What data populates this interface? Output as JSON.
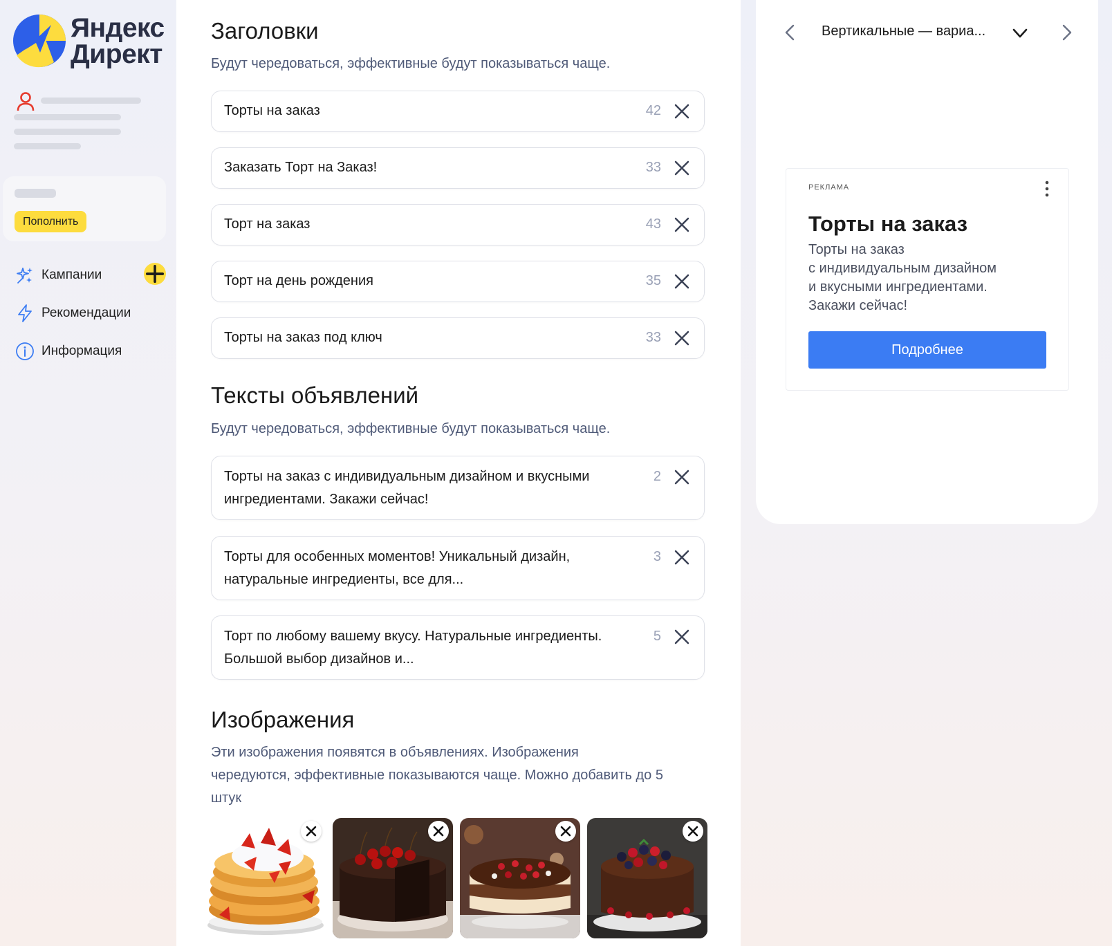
{
  "brand": {
    "line1": "Яндекс",
    "line2": "Директ",
    "colors": {
      "yellow": "#fddc3e",
      "blue": "#2d5fe8",
      "accent": "#3b7cf3"
    }
  },
  "sidebar": {
    "topup_label": "Пополнить",
    "nav": [
      {
        "label": "Кампании",
        "icon": "sparkles-icon"
      },
      {
        "label": "Рекомендации",
        "icon": "lightning-icon"
      },
      {
        "label": "Информация",
        "icon": "info-icon"
      }
    ]
  },
  "headlines": {
    "title": "Заголовки",
    "subtitle": "Будут чередоваться, эффективные будут показываться чаще.",
    "items": [
      {
        "text": "Торты на заказ",
        "count": "42"
      },
      {
        "text": "Заказать Торт на Заказ!",
        "count": "33"
      },
      {
        "text": "Торт на заказ",
        "count": "43"
      },
      {
        "text": "Торт на день рождения",
        "count": "35"
      },
      {
        "text": "Торты на заказ под ключ",
        "count": "33"
      }
    ]
  },
  "texts": {
    "title": "Тексты объявлений",
    "subtitle": "Будут чередоваться, эффективные будут показываться чаще.",
    "items": [
      {
        "line1": "Торты на заказ с индивидуальным дизайном и вкусными",
        "line2": "ингредиентами. Закажи сейчас!",
        "count": "2"
      },
      {
        "line1": "Торты для особенных моментов! Уникальный дизайн,",
        "line2": "натуральные ингредиенты, все для...",
        "count": "3"
      },
      {
        "line1": "Торт по любому вашему вкусу. Натуральные ингредиенты.",
        "line2": "Большой выбор дизайнов и...",
        "count": "5"
      }
    ]
  },
  "images": {
    "title": "Изображения",
    "subtitle_lines": [
      "Эти изображения появятся в объявлениях. Изображения",
      "чередуются, эффективные показываются чаще. Можно добавить до 5",
      "штук"
    ],
    "thumbs": [
      {
        "name": "strawberry-waffle-cake"
      },
      {
        "name": "chocolate-cherry-cake"
      },
      {
        "name": "chocolate-berry-cream-cake"
      },
      {
        "name": "chocolate-berry-cake"
      }
    ]
  },
  "preview": {
    "variant": "Вертикальные — вариа...",
    "ad_label": "РЕКЛАМА",
    "ad_title": "Торты на заказ",
    "ad_text_lines": [
      "Торты на заказ",
      "с индивидуальным дизайном",
      "и вкусными ингредиентами.",
      "Закажи сейчас!"
    ],
    "cta": "Подробнее"
  }
}
